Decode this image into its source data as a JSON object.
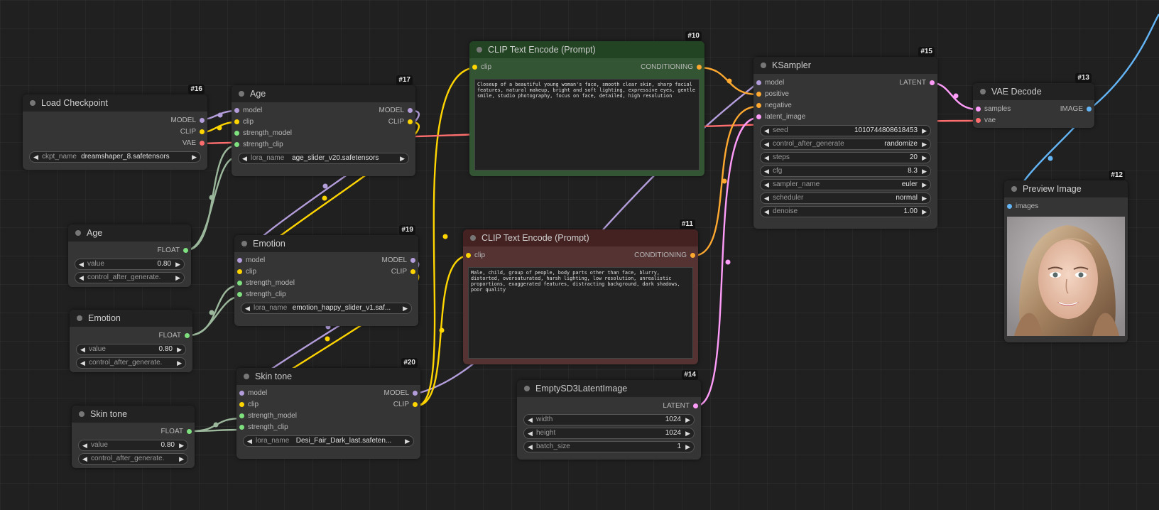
{
  "nodes": {
    "load_checkpoint": {
      "id": "#16",
      "title": "Load Checkpoint",
      "outputs": [
        "MODEL",
        "CLIP",
        "VAE"
      ],
      "ckpt_label": "ckpt_name",
      "ckpt_value": "dreamshaper_8.safetensors"
    },
    "age_lora": {
      "id": "#17",
      "title": "Age",
      "inputs": [
        "model",
        "clip",
        "strength_model",
        "strength_clip"
      ],
      "outputs": [
        "MODEL",
        "CLIP"
      ],
      "lora_label": "lora_name",
      "lora_value": "age_slider_v20.safetensors"
    },
    "emotion_lora": {
      "id": "#19",
      "title": "Emotion",
      "inputs": [
        "model",
        "clip",
        "strength_model",
        "strength_clip"
      ],
      "outputs": [
        "MODEL",
        "CLIP"
      ],
      "lora_label": "lora_name",
      "lora_value": "emotion_happy_slider_v1.saf..."
    },
    "skin_lora": {
      "id": "#20",
      "title": "Skin tone",
      "inputs": [
        "model",
        "clip",
        "strength_model",
        "strength_clip"
      ],
      "outputs": [
        "MODEL",
        "CLIP"
      ],
      "lora_label": "lora_name",
      "lora_value": "Desi_Fair_Dark_last.safeten..."
    },
    "age_float": {
      "title": "Age",
      "output": "FLOAT",
      "value_label": "value",
      "value": "0.80",
      "cag_label": "control_after_generate."
    },
    "emotion_float": {
      "title": "Emotion",
      "output": "FLOAT",
      "value_label": "value",
      "value": "0.80",
      "cag_label": "control_after_generate."
    },
    "skin_float": {
      "title": "Skin tone",
      "output": "FLOAT",
      "value_label": "value",
      "value": "0.80",
      "cag_label": "control_after_generate."
    },
    "clip_pos": {
      "id": "#10",
      "title": "CLIP Text Encode (Prompt)",
      "input": "clip",
      "output": "CONDITIONING",
      "text": "Closeup of a beautiful young woman's face, smooth clear skin, sharp facial features, natural makeup, bright and soft lighting, expressive eyes, gentle smile, studio photography, focus on face, detailed, high resolution"
    },
    "clip_neg": {
      "id": "#11",
      "title": "CLIP Text Encode (Prompt)",
      "input": "clip",
      "output": "CONDITIONING",
      "text": "Male, child, group of people, body parts other than face, blurry, distorted, oversaturated, harsh lighting, low resolution, unrealistic proportions, exaggerated features, distracting background, dark shadows, poor quality"
    },
    "ksampler": {
      "id": "#15",
      "title": "KSampler",
      "inputs": [
        "model",
        "positive",
        "negative",
        "latent_image"
      ],
      "output": "LATENT",
      "widgets": [
        {
          "label": "seed",
          "value": "1010744808618453"
        },
        {
          "label": "control_after_generate",
          "value": "randomize"
        },
        {
          "label": "steps",
          "value": "20"
        },
        {
          "label": "cfg",
          "value": "8.3"
        },
        {
          "label": "sampler_name",
          "value": "euler"
        },
        {
          "label": "scheduler",
          "value": "normal"
        },
        {
          "label": "denoise",
          "value": "1.00"
        }
      ]
    },
    "vae_decode": {
      "id": "#13",
      "title": "VAE Decode",
      "inputs": [
        "samples",
        "vae"
      ],
      "output": "IMAGE"
    },
    "preview": {
      "id": "#12",
      "title": "Preview Image",
      "input": "images"
    },
    "latent": {
      "id": "#14",
      "title": "EmptySD3LatentImage",
      "output": "LATENT",
      "widgets": [
        {
          "label": "width",
          "value": "1024"
        },
        {
          "label": "height",
          "value": "1024"
        },
        {
          "label": "batch_size",
          "value": "1"
        }
      ]
    }
  },
  "colors": {
    "model": "#b39ddb",
    "clip": "#ffd500",
    "vae": "#ff6e6e",
    "float": "#9cb89c",
    "float_socket": "#7ee07e",
    "conditioning": "#ffa931",
    "latent": "#ff9cf9",
    "image": "#64b5f6"
  },
  "icons": {
    "widget_left": "triangle-left-icon",
    "widget_right": "triangle-right-icon",
    "node_dot": "collapse-dot-icon"
  }
}
